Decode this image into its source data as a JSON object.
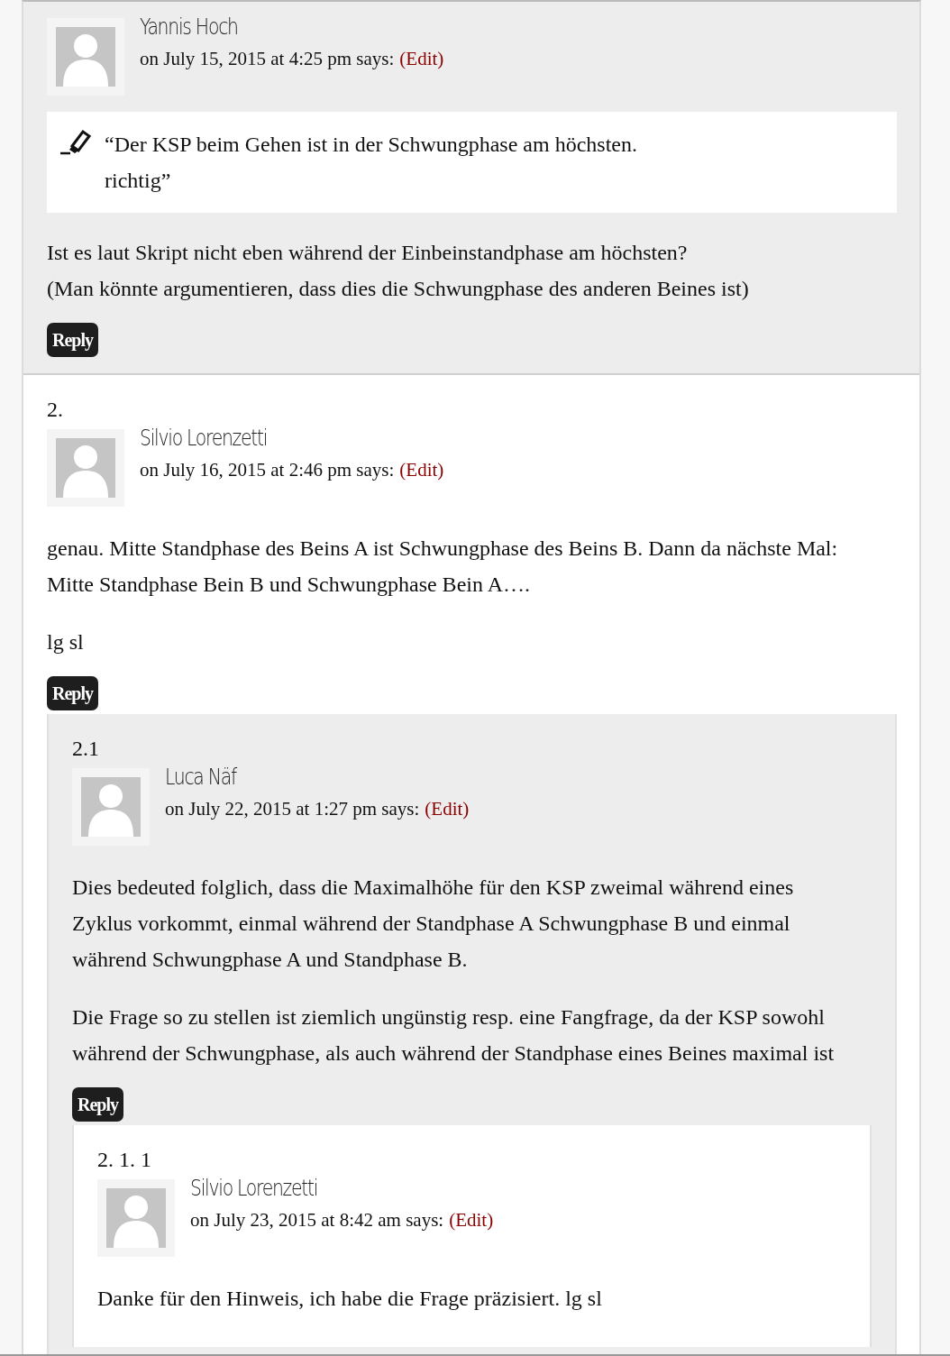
{
  "comments": [
    {
      "author": "Yannis Hoch",
      "meta": "on July 15, 2015 at 4:25 pm says:",
      "edit": "(Edit)",
      "quote": [
        "“Der KSP beim Gehen ist in der Schwungphase am höchsten.",
        "richtig”"
      ],
      "paragraphs": [
        [
          "Ist es laut Skript nicht eben während der Einbeinstandphase am höchsten?",
          "(Man könnte argumentieren, dass dies die Schwungphase des anderen Beines ist)"
        ]
      ],
      "reply": "Reply"
    },
    {
      "number": "2.",
      "author": "Silvio Lorenzetti",
      "meta": "on July 16, 2015 at 2:46 pm says:",
      "edit": "(Edit)",
      "paragraphs": [
        [
          "genau. Mitte Standphase des Beins A ist Schwungphase des Beins B. Dann da nächste Mal: Mitte Standphase Bein B und Schwungphase Bein A…."
        ],
        [
          "lg sl"
        ]
      ],
      "reply": "Reply",
      "children": [
        {
          "number": "2.1",
          "author": "Luca Näf",
          "meta": "on July 22, 2015 at 1:27 pm says:",
          "edit": "(Edit)",
          "paragraphs": [
            [
              "Dies bedeuted folglich, dass die Maximalhöhe für den KSP zweimal während eines Zyklus vorkommt, einmal während der Standphase A Schwungphase B und einmal während Schwungphase A und Standphase B."
            ],
            [
              "Die Frage so zu stellen ist ziemlich ungünstig resp. eine Fangfrage, da der KSP sowohl während der Schwungphase, als auch während der Standphase eines Beines maximal ist"
            ]
          ],
          "reply": "Reply",
          "children": [
            {
              "number": "2. 1. 1",
              "author": "Silvio Lorenzetti",
              "meta": "on July 23, 2015 at 8:42 am says:",
              "edit": "(Edit)",
              "paragraphs": [
                [
                  "Danke für den Hinweis, ich habe die Frage präzisiert. lg sl"
                ]
              ]
            }
          ]
        }
      ]
    }
  ]
}
